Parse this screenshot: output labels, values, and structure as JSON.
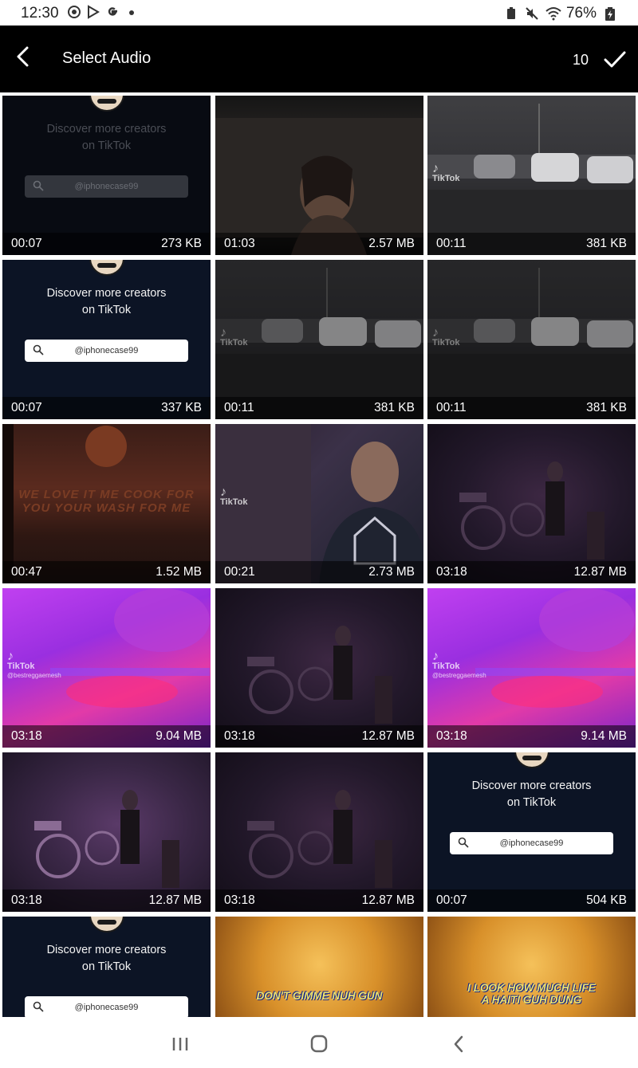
{
  "status_bar": {
    "time": "12:30",
    "left_icons": [
      "sync-icon",
      "play-store-icon",
      "google-icon",
      "dot-icon"
    ],
    "battery": "76%",
    "right_icons": [
      "battery-saver-icon",
      "mute-icon",
      "wifi-icon",
      "battery-charging-icon"
    ]
  },
  "app_bar": {
    "title": "Select Audio",
    "selected_count": "10",
    "back_icon": "back-arrow-icon",
    "confirm_icon": "checkmark-icon"
  },
  "grid": {
    "items": [
      {
        "duration": "00:07",
        "size": "273 KB",
        "thumb": "discover-dim",
        "text1": "Discover more creators",
        "text2": "on TikTok",
        "handle": "@iphonecase99"
      },
      {
        "duration": "01:03",
        "size": "2.57 MB",
        "thumb": "portrait"
      },
      {
        "duration": "00:11",
        "size": "381 KB",
        "thumb": "parking",
        "watermark": "TikTok"
      },
      {
        "duration": "00:07",
        "size": "337 KB",
        "thumb": "discover",
        "text1": "Discover more creators",
        "text2": "on TikTok",
        "handle": "@iphonecase99"
      },
      {
        "duration": "00:11",
        "size": "381 KB",
        "thumb": "parking-dark",
        "watermark": "TikTok"
      },
      {
        "duration": "00:11",
        "size": "381 KB",
        "thumb": "parking-dark",
        "watermark": "TikTok"
      },
      {
        "duration": "00:47",
        "size": "1.52 MB",
        "thumb": "sunset",
        "caption1": "WE LOVE IT ME COOK FOR",
        "caption2": "YOU YOUR WASH FOR ME"
      },
      {
        "duration": "00:21",
        "size": "2.73 MB",
        "thumb": "podcast",
        "watermark": "TikTok"
      },
      {
        "duration": "03:18",
        "size": "12.87 MB",
        "thumb": "stage"
      },
      {
        "duration": "03:18",
        "size": "9.04 MB",
        "thumb": "purple",
        "watermark": "TikTok",
        "watermark_handle": "@bestreggaemesh"
      },
      {
        "duration": "03:18",
        "size": "12.87 MB",
        "thumb": "stage"
      },
      {
        "duration": "03:18",
        "size": "9.14 MB",
        "thumb": "purple",
        "watermark": "TikTok",
        "watermark_handle": "@bestreggaemesh"
      },
      {
        "duration": "03:18",
        "size": "12.87 MB",
        "thumb": "stage-bright"
      },
      {
        "duration": "03:18",
        "size": "12.87 MB",
        "thumb": "stage"
      },
      {
        "duration": "00:07",
        "size": "504 KB",
        "thumb": "discover",
        "text1": "Discover more creators",
        "text2": "on TikTok",
        "handle": "@iphonecase99"
      },
      {
        "duration": "",
        "size": "",
        "thumb": "discover",
        "text1": "Discover more creators",
        "text2": "on TikTok",
        "handle": "@iphonecase99"
      },
      {
        "duration": "",
        "size": "",
        "thumb": "gold",
        "caption1": "DON'T GIMME NUH GUN"
      },
      {
        "duration": "",
        "size": "",
        "thumb": "gold",
        "caption1": "I LOOK HOW MUCH LIFE",
        "caption2": "A HAITI GUH DUNG"
      }
    ]
  },
  "nav_bar": {
    "icons": [
      "recent-apps-icon",
      "home-icon",
      "back-icon"
    ]
  },
  "colors": {
    "app_bar_bg": "#000000",
    "app_bar_text": "#ffffff",
    "status_bar_bg": "#ffffff"
  }
}
